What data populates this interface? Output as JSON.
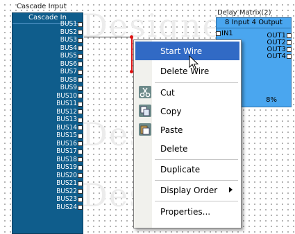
{
  "watermark": "Designer",
  "cascade_input": {
    "component_label": "Cascade Input",
    "block_title": "Cascade In",
    "bus_labels": [
      "BUS1",
      "BUS2",
      "BUS3",
      "BUS4",
      "BUS5",
      "BUS6",
      "BUS7",
      "BUS8",
      "BUS9",
      "BUS10",
      "BUS11",
      "BUS12",
      "BUS13",
      "BUS14",
      "BUS15",
      "BUS16",
      "BUS17",
      "BUS18",
      "BUS19",
      "BUS20",
      "BUS21",
      "BUS22",
      "BUS23",
      "BUS24"
    ]
  },
  "delay_matrix": {
    "component_label": "Delay Matrix(2)",
    "block_title": "8 Input 4 Output",
    "input_port": "IN1",
    "outputs": [
      "OUT1",
      "OUT2",
      "OUT3",
      "OUT4"
    ],
    "percent": "8%"
  },
  "context_menu": {
    "items": [
      {
        "label": "Start Wire",
        "highlighted": true
      },
      {
        "label": "Delete Wire"
      },
      {
        "label": "Cut",
        "icon": "scissors-icon"
      },
      {
        "label": "Copy",
        "icon": "copy-icon"
      },
      {
        "label": "Paste",
        "icon": "paste-icon"
      },
      {
        "label": "Delete"
      },
      {
        "label": "Duplicate"
      },
      {
        "label": "Display Order",
        "has_submenu": true
      },
      {
        "label": "Properties..."
      }
    ]
  },
  "colors": {
    "cascade_block": "#0f5d8c",
    "delay_block": "#4aa6ef",
    "menu_highlight": "#316ac5",
    "wire": "#dd1111"
  }
}
